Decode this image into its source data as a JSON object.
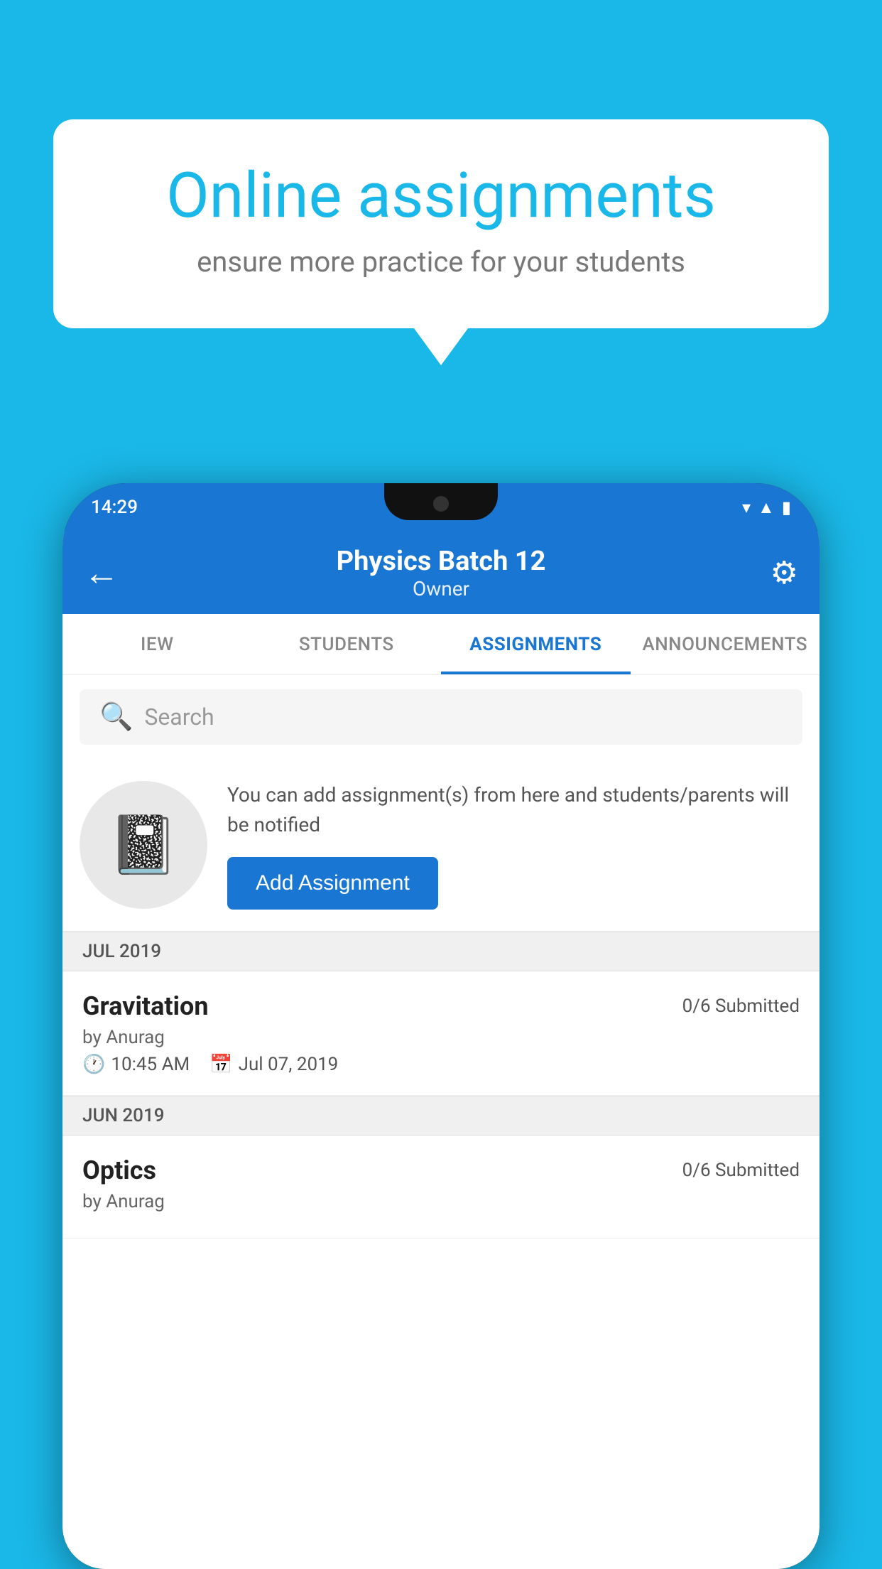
{
  "background": {
    "color": "#1ab8e8"
  },
  "speech_bubble": {
    "title": "Online assignments",
    "subtitle": "ensure more practice for your students"
  },
  "status_bar": {
    "time": "14:29",
    "wifi_icon": "wifi",
    "signal_icon": "signal",
    "battery_icon": "battery"
  },
  "app_bar": {
    "title": "Physics Batch 12",
    "subtitle": "Owner",
    "back_icon": "←",
    "settings_icon": "⚙"
  },
  "tabs": [
    {
      "label": "IEW",
      "active": false
    },
    {
      "label": "STUDENTS",
      "active": false
    },
    {
      "label": "ASSIGNMENTS",
      "active": true
    },
    {
      "label": "ANNOUNCEMENTS",
      "active": false
    }
  ],
  "search": {
    "placeholder": "Search",
    "icon": "🔍"
  },
  "promo": {
    "description": "You can add assignment(s) from here and students/parents will be notified",
    "button_label": "Add Assignment"
  },
  "months": [
    {
      "label": "JUL 2019",
      "assignments": [
        {
          "title": "Gravitation",
          "submitted": "0/6 Submitted",
          "by": "by Anurag",
          "time": "10:45 AM",
          "date": "Jul 07, 2019"
        }
      ]
    },
    {
      "label": "JUN 2019",
      "assignments": [
        {
          "title": "Optics",
          "submitted": "0/6 Submitted",
          "by": "by Anurag",
          "time": "",
          "date": ""
        }
      ]
    }
  ]
}
